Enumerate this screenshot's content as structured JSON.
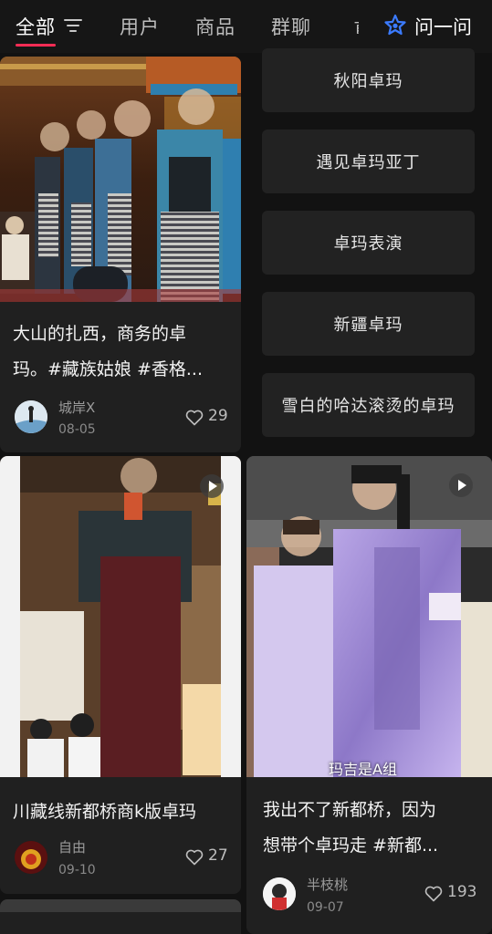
{
  "tabs": [
    {
      "label": "全部"
    },
    {
      "label": "用户"
    },
    {
      "label": "商品"
    },
    {
      "label": "群聊"
    }
  ],
  "ask": {
    "label": "问一问",
    "icon": "ask-star-icon"
  },
  "suggestions": [
    "秋阳卓玛",
    "遇见卓玛亚丁",
    "卓玛表演",
    "新疆卓玛",
    "雪白的哈达滚烫的卓玛"
  ],
  "cards": [
    {
      "title_line1": "大山的扎西，商务的卓",
      "title_line2": "玛。#藏族姑娘 #香格...",
      "author": "城岸X",
      "date": "08-05",
      "likes": "29",
      "is_video": false
    },
    {
      "title_line1": "川藏线新都桥商k版卓玛",
      "author": "自由",
      "date": "09-10",
      "likes": "27",
      "is_video": true
    },
    {
      "title_line1": "我出不了新都桥，因为",
      "title_line2": "想带个卓玛走 #新都...",
      "author": "半枝桃",
      "date": "09-07",
      "likes": "193",
      "is_video": true,
      "subtitle": "玛吉是A组"
    }
  ],
  "colors": {
    "background": "#121212",
    "card": "#202020",
    "accent": "#ff2d55",
    "ask_icon": "#3b7bff"
  }
}
